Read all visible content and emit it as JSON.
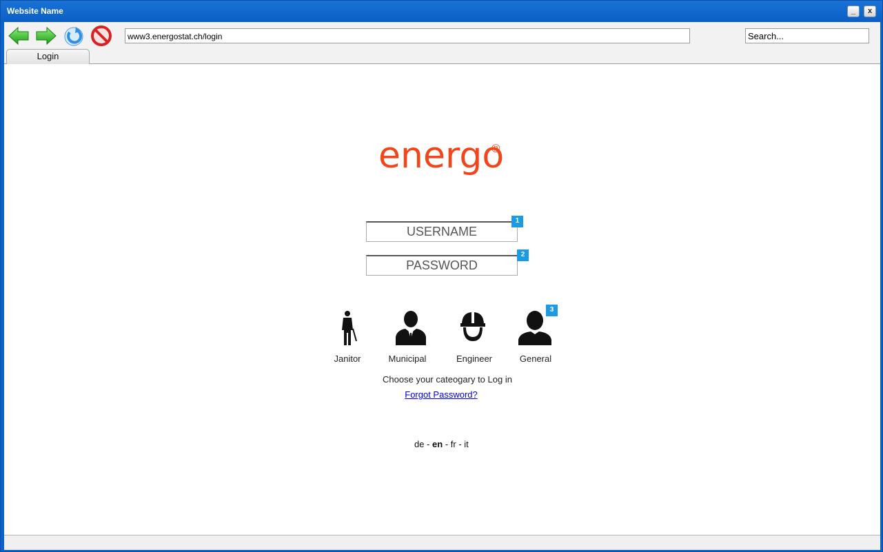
{
  "window": {
    "title": "Website Name",
    "minimize_label": "_",
    "close_label": "x"
  },
  "toolbar": {
    "url": "www3.energostat.ch/login",
    "search_placeholder": "Search...",
    "icons": [
      "back-arrow-icon",
      "forward-arrow-icon",
      "refresh-icon",
      "stop-icon"
    ]
  },
  "tabs": [
    {
      "label": "Login"
    }
  ],
  "logo": {
    "text": "energo",
    "registered": "®",
    "color": "#f0461c"
  },
  "form": {
    "username_placeholder": "USERNAME",
    "password_placeholder": "PASSWORD",
    "badges": [
      "1",
      "2",
      "3"
    ]
  },
  "categories": [
    {
      "label": "Janitor",
      "icon": "janitor-icon"
    },
    {
      "label": "Municipal",
      "icon": "municipal-icon"
    },
    {
      "label": "Engineer",
      "icon": "engineer-icon"
    },
    {
      "label": "General",
      "icon": "general-user-icon"
    }
  ],
  "hint": "Choose your cateogary to Log in",
  "forgot_password": "Forgot Password?",
  "languages": {
    "de": "de",
    "en": "en",
    "fr": "fr",
    "it": "it",
    "separator": " - ",
    "active": "en"
  }
}
